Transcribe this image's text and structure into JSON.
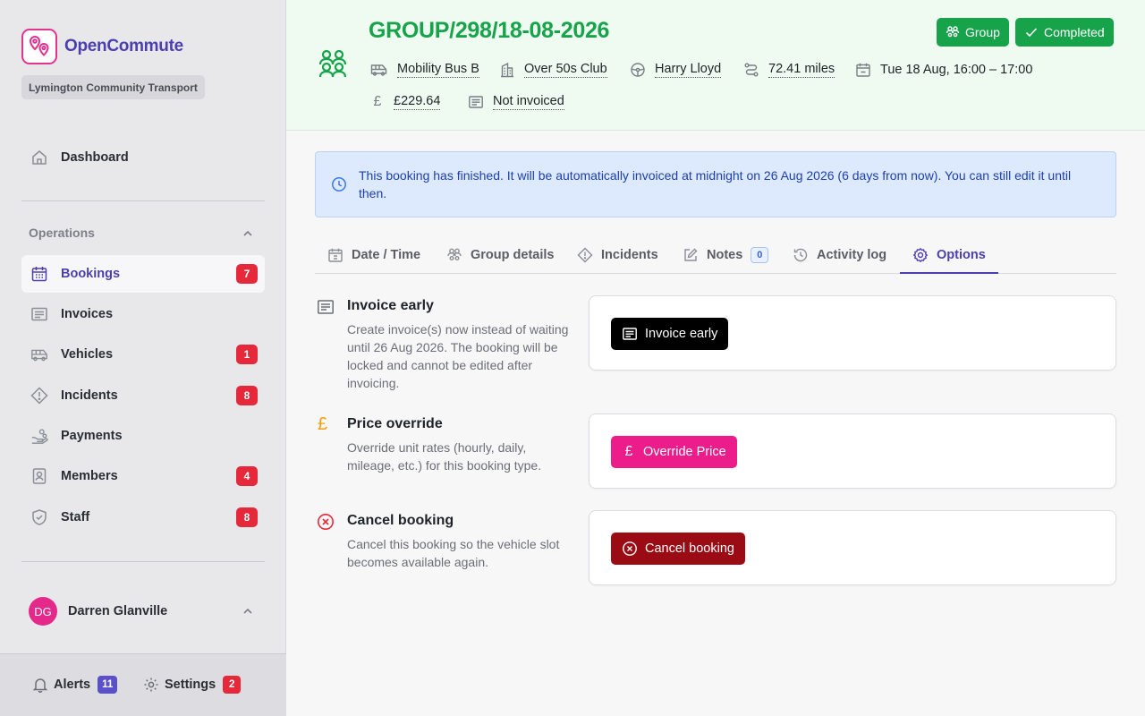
{
  "app": {
    "brand_name": "OpenCommute",
    "org_name": "Lymington Community Transport"
  },
  "sidebar": {
    "dashboard_label": "Dashboard",
    "section_label": "Operations",
    "items": [
      {
        "label": "Bookings",
        "badge": "7",
        "icon": "calendar-icon",
        "active": true
      },
      {
        "label": "Invoices",
        "badge": "",
        "icon": "invoice-icon"
      },
      {
        "label": "Vehicles",
        "badge": "1",
        "icon": "bus-icon"
      },
      {
        "label": "Incidents",
        "badge": "8",
        "icon": "warning-icon"
      },
      {
        "label": "Payments",
        "badge": "",
        "icon": "hand-coins-icon"
      },
      {
        "label": "Members",
        "badge": "4",
        "icon": "member-card-icon"
      },
      {
        "label": "Staff",
        "badge": "8",
        "icon": "shield-icon"
      }
    ],
    "user": {
      "initials": "DG",
      "name": "Darren Glanville"
    },
    "footer": {
      "alerts_label": "Alerts",
      "alerts_count": "11",
      "settings_label": "Settings",
      "settings_count": "2"
    }
  },
  "header": {
    "title": "GROUP/298/18-08-2026",
    "group_tag": "Group",
    "status_tag": "Completed",
    "vehicle": "Mobility Bus B",
    "group": "Over 50s Club",
    "driver": "Harry Lloyd",
    "distance": "72.41 miles",
    "datetime": "Tue 18 Aug, 16:00 – 17:00",
    "price": "£229.64",
    "invoice_status": "Not invoiced"
  },
  "alert": {
    "text": "This booking has finished. It will be automatically invoiced at midnight on 26 Aug 2026 (6 days from now). You can still edit it until then."
  },
  "tabs": [
    {
      "label": "Date / Time"
    },
    {
      "label": "Group details"
    },
    {
      "label": "Incidents"
    },
    {
      "label": "Notes",
      "count": "0"
    },
    {
      "label": "Activity log"
    },
    {
      "label": "Options",
      "active": true
    }
  ],
  "options": [
    {
      "title": "Invoice early",
      "description": "Create invoice(s) now instead of waiting until 26 Aug 2026. The booking will be locked and cannot be edited after invoicing.",
      "button": "Invoice early",
      "color": "#000000"
    },
    {
      "title": "Price override",
      "description": "Override unit rates (hourly, daily, mileage, etc.) for this booking type.",
      "button": "Override Price",
      "color": "#ec1c8a"
    },
    {
      "title": "Cancel booking",
      "description": "Cancel this booking so the vehicle slot becomes available again.",
      "button": "Cancel booking",
      "color": "#9b0b13"
    }
  ],
  "colors": {
    "accent": "#4b3fb0",
    "success": "#16a34a",
    "badge": "#e5293a",
    "brand_pink": "#e0338f"
  }
}
